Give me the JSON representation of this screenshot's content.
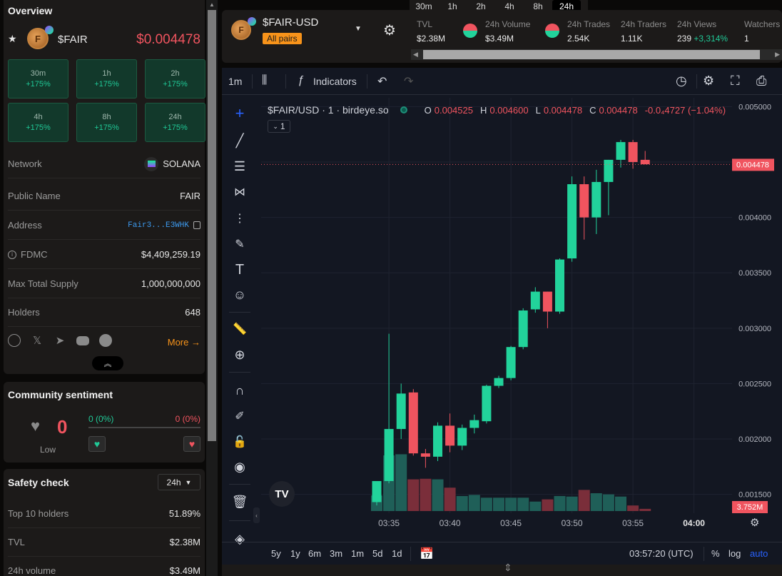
{
  "overview": {
    "title": "Overview",
    "token_symbol": "$FAIR",
    "price": "$0.004478",
    "timeframes": [
      {
        "label": "30m",
        "pct": "+175%"
      },
      {
        "label": "1h",
        "pct": "+175%"
      },
      {
        "label": "2h",
        "pct": "+175%"
      },
      {
        "label": "4h",
        "pct": "+175%"
      },
      {
        "label": "8h",
        "pct": "+175%"
      },
      {
        "label": "24h",
        "pct": "+175%"
      }
    ],
    "network_label": "Network",
    "network_value": "SOLANA",
    "public_name_label": "Public Name",
    "public_name_value": "FAIR",
    "address_label": "Address",
    "address_value": "Fair3...E3WHK",
    "fdmc_label": "FDMC",
    "fdmc_value": "$4,409,259.19",
    "supply_label": "Max Total Supply",
    "supply_value": "1,000,000,000",
    "holders_label": "Holders",
    "holders_value": "648",
    "more_label": "More"
  },
  "sentiment": {
    "title": "Community sentiment",
    "score": "0",
    "level": "Low",
    "bull": "0 (0%)",
    "bear": "0 (0%)"
  },
  "safety": {
    "title": "Safety check",
    "period": "24h",
    "rows": [
      {
        "label": "Top 10 holders",
        "value": "51.89%"
      },
      {
        "label": "TVL",
        "value": "$2.38M"
      },
      {
        "label": "24h volume",
        "value": "$3.49M"
      }
    ]
  },
  "header": {
    "pair": "$FAIR-USD",
    "all_pairs": "All pairs",
    "tabs": [
      "30m",
      "1h",
      "2h",
      "4h",
      "8h",
      "24h"
    ],
    "active_tab": "24h",
    "stats": [
      {
        "label": "TVL",
        "value": "$2.38M"
      },
      {
        "label": "24h Volume",
        "value": "$3.49M"
      },
      {
        "label": "24h Trades",
        "value": "2.54K"
      },
      {
        "label": "24h Traders",
        "value": "1.11K"
      },
      {
        "label": "24h Views",
        "value": "239"
      },
      {
        "label": "Watchers",
        "value": "1"
      }
    ],
    "views_change": "+3,314%"
  },
  "chart_toolbar": {
    "interval": "1m",
    "indicators": "Indicators"
  },
  "legend": {
    "title": "$FAIR/USD · 1 · birdeye.so",
    "o_label": "O",
    "o": "0.004525",
    "h_label": "H",
    "h": "0.004600",
    "l_label": "L",
    "l": "0.004478",
    "c_label": "C",
    "c": "0.004478",
    "change": "-0.0₄4727 (−1.04%)",
    "collapse": "1"
  },
  "bottom": {
    "ranges": [
      "5y",
      "1y",
      "6m",
      "3m",
      "1m",
      "5d",
      "1d"
    ],
    "time": "03:57:20 (UTC)",
    "pct": "%",
    "log": "log",
    "auto": "auto"
  },
  "colors": {
    "up": "#26a69a",
    "up_bright": "#22d39b",
    "down": "#f0545f",
    "accent": "#f7931a",
    "price_tag": "#f0545f"
  },
  "chart_data": {
    "type": "candlestick",
    "y_ticks": [
      "0.005000",
      "0.004500",
      "0.004000",
      "0.003500",
      "0.003000",
      "0.002500",
      "0.002000",
      "0.001500"
    ],
    "ylim": [
      0.00133,
      0.00508
    ],
    "x_ticks": [
      "03:35",
      "03:40",
      "03:45",
      "03:50",
      "03:55",
      "04:00"
    ],
    "last_price": "0.004478",
    "volume_label": "3.752M",
    "candles": [
      {
        "t": "03:34",
        "o": 0.00143,
        "h": 0.00145,
        "l": 0.0014,
        "c": 0.00162
      },
      {
        "t": "03:35",
        "o": 0.00162,
        "h": 0.00295,
        "l": 0.0016,
        "c": 0.00209
      },
      {
        "t": "03:36",
        "o": 0.00209,
        "h": 0.0025,
        "l": 0.002,
        "c": 0.00241
      },
      {
        "t": "03:37",
        "o": 0.00242,
        "h": 0.00245,
        "l": 0.00185,
        "c": 0.00187
      },
      {
        "t": "03:38",
        "o": 0.00187,
        "h": 0.00191,
        "l": 0.00174,
        "c": 0.00184
      },
      {
        "t": "03:39",
        "o": 0.00184,
        "h": 0.00215,
        "l": 0.0018,
        "c": 0.00212
      },
      {
        "t": "03:40",
        "o": 0.00212,
        "h": 0.00223,
        "l": 0.00188,
        "c": 0.00194
      },
      {
        "t": "03:41",
        "o": 0.00194,
        "h": 0.00213,
        "l": 0.0019,
        "c": 0.0021
      },
      {
        "t": "03:42",
        "o": 0.0021,
        "h": 0.00222,
        "l": 0.00205,
        "c": 0.00217
      },
      {
        "t": "03:43",
        "o": 0.00216,
        "h": 0.00249,
        "l": 0.00214,
        "c": 0.00248
      },
      {
        "t": "03:44",
        "o": 0.00248,
        "h": 0.00257,
        "l": 0.00246,
        "c": 0.00255
      },
      {
        "t": "03:45",
        "o": 0.00255,
        "h": 0.00284,
        "l": 0.00253,
        "c": 0.00283
      },
      {
        "t": "03:46",
        "o": 0.00283,
        "h": 0.00318,
        "l": 0.00281,
        "c": 0.00316
      },
      {
        "t": "03:47",
        "o": 0.00317,
        "h": 0.00337,
        "l": 0.00314,
        "c": 0.00333
      },
      {
        "t": "03:48",
        "o": 0.00333,
        "h": 0.00333,
        "l": 0.003,
        "c": 0.00315
      },
      {
        "t": "03:49",
        "o": 0.00315,
        "h": 0.00363,
        "l": 0.00313,
        "c": 0.00362
      },
      {
        "t": "03:50",
        "o": 0.00363,
        "h": 0.00437,
        "l": 0.0036,
        "c": 0.0043
      },
      {
        "t": "03:51",
        "o": 0.0043,
        "h": 0.00437,
        "l": 0.0038,
        "c": 0.004
      },
      {
        "t": "03:52",
        "o": 0.004,
        "h": 0.00443,
        "l": 0.00385,
        "c": 0.00432
      },
      {
        "t": "03:53",
        "o": 0.00432,
        "h": 0.00442,
        "l": 0.00402,
        "c": 0.00452
      },
      {
        "t": "03:54",
        "o": 0.00452,
        "h": 0.0047,
        "l": 0.00445,
        "c": 0.00468
      },
      {
        "t": "03:55",
        "o": 0.00468,
        "h": 0.0047,
        "l": 0.00444,
        "c": 0.0045
      },
      {
        "t": "03:56",
        "o": 0.00452,
        "h": 0.0046,
        "l": 0.00448,
        "c": 0.00448
      }
    ],
    "volumes": [
      0.28,
      1.0,
      1.02,
      0.57,
      0.58,
      0.57,
      0.42,
      0.27,
      0.29,
      0.24,
      0.24,
      0.24,
      0.24,
      0.17,
      0.21,
      0.27,
      0.26,
      0.38,
      0.32,
      0.3,
      0.26,
      0.1,
      0.04
    ]
  }
}
